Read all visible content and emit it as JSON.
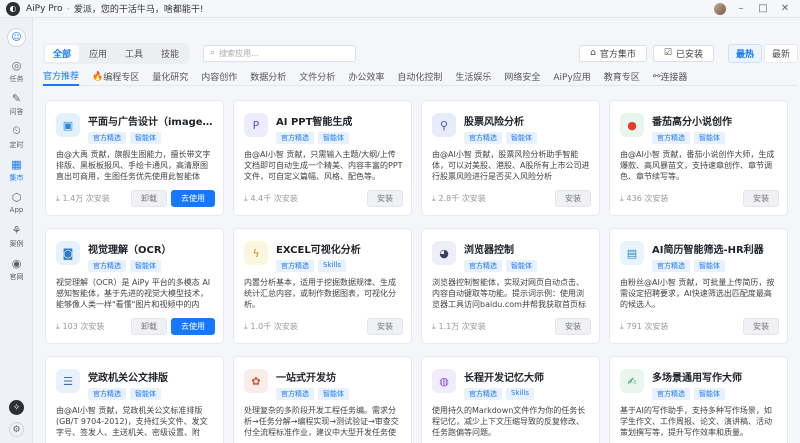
{
  "titlebar": {
    "app": "AiPy Pro",
    "sep": "-",
    "greeting": "爱派，您的干活牛马，啥都能干!"
  },
  "sidebar": [
    {
      "label": "任务",
      "icon": "◎"
    },
    {
      "label": "问答",
      "icon": "✎"
    },
    {
      "label": "定时",
      "icon": "⏲"
    },
    {
      "label": "集市",
      "icon": "▦"
    },
    {
      "label": "App",
      "icon": "⬡"
    },
    {
      "label": "案例",
      "icon": "⚘"
    },
    {
      "label": "官网",
      "icon": "◉"
    }
  ],
  "filters": {
    "segments": [
      "全部",
      "应用",
      "工具",
      "技能"
    ],
    "search_placeholder": "搜索应用...",
    "official_store": "官方集市",
    "installed": "已安装",
    "sort_hot": "最热",
    "sort_new": "最新"
  },
  "tabs": [
    "官方推荐",
    "编程专区",
    "量化研究",
    "内容创作",
    "数据分析",
    "文件分析",
    "办公效率",
    "自动化控制",
    "生活娱乐",
    "网络安全",
    "AiPy应用",
    "教育专区",
    "连接器"
  ],
  "cards": [
    {
      "title": "平面与广告设计（image2）",
      "tags": [
        "官方精选",
        "智能体"
      ],
      "desc": "由@大禹 贡献，旗舰生图能力，擅长带文字排版、黑板板报风、手绘卡通风，高清原图直出可商用，生图任务优先使用此智能体",
      "installs": "1.4万 次安装",
      "buttons": [
        "卸载",
        "去使用"
      ],
      "icon": "▣",
      "icon_bg": "#e3f1fb",
      "icon_color": "#2a8bd8"
    },
    {
      "title": "AI PPT智能生成",
      "tags": [
        "官方精选",
        "智能体"
      ],
      "desc": "由@AI小智 贡献，只需输入主题/大纲/上传文档即可自动生成一个精美、内容丰富的PPT文件，可自定义篇幅、风格、配色等。",
      "installs": "4.4千 次安装",
      "buttons": [
        "安装"
      ],
      "icon": "P",
      "icon_bg": "#ecebff",
      "icon_color": "#5b57d6"
    },
    {
      "title": "股票风险分析",
      "tags": [
        "官方精选",
        "智能体"
      ],
      "desc": "由@AI小智 贡献，股票风险分析助手智能体，可以对美股、港股、A股所有上市公司进行股票风险进行是否买入风险分析",
      "installs": "2.8千 次安装",
      "buttons": [
        "安装"
      ],
      "icon": "⚲",
      "icon_bg": "#e8ecf9",
      "icon_color": "#3b56b6"
    },
    {
      "title": "番茄高分小说创作",
      "tags": [
        "官方精选",
        "智能体"
      ],
      "desc": "由@AI小智 贡献，番茄小说创作大师，生成爆款、高风暴苗文，支持速章创作、章节调色、章节续写等。",
      "installs": "436 次安装",
      "buttons": [
        "安装"
      ],
      "icon": "●",
      "icon_bg": "#e9f5ec",
      "icon_color": "#e23b2e"
    },
    {
      "title": "视觉理解（OCR）",
      "tags": [
        "官方精选",
        "智能体"
      ],
      "desc": "视觉理解（OCR）是 AiPy 平台的多模态 AI 感知智能体，基于先进的视觉大模型技术，能够像人类一样\"看懂\"图片和视频中的内容。无论是提取图",
      "installs": "103 次安装",
      "buttons": [
        "卸载",
        "去使用"
      ],
      "icon": "◙",
      "icon_bg": "#e6f1fb",
      "icon_color": "#2c7ac9"
    },
    {
      "title": "EXCEL可视化分析",
      "tags": [
        "官方精选",
        "Skills"
      ],
      "desc": "内置分析基本，适用于挖掘数据规律、生成统计汇总内容，或制作数据图表，可视化分析。",
      "installs": "1.0千 次安装",
      "buttons": [
        "安装"
      ],
      "icon": "ϟ",
      "icon_bg": "#fbf6dd",
      "icon_color": "#c08a16"
    },
    {
      "title": "浏览器控制",
      "tags": [
        "官方精选",
        "智能体"
      ],
      "desc": "浏览器控制智能体，实现对网页自动点击、内容自动键取等功能。提示词示例：使用浏览器工具访问baidu.com并帮我获取首页标题",
      "installs": "1.1万 次安装",
      "buttons": [
        "安装"
      ],
      "icon": "◕",
      "icon_bg": "#edeef8",
      "icon_color": "#3a3f60"
    },
    {
      "title": "AI简历智能筛选-HR利器",
      "tags": [
        "官方精选",
        "智能体"
      ],
      "desc": "由粉丝@AI小智 贡献，可批量上传简历，按需设定招聘要求，AI快速筛选出匹配度最高的候选人。",
      "installs": "791 次安装",
      "buttons": [
        "安装"
      ],
      "icon": "▤",
      "icon_bg": "#e7f4fb",
      "icon_color": "#2a85c1"
    },
    {
      "title": "党政机关公文排版",
      "tags": [
        "官方精选",
        "智能体"
      ],
      "desc": "由@AI小智 贡献，党政机关公文标准排版(GB/T 9704-2012)，支持红头文件、发文字号、签发人、主送机关、密级设置、附注、版记等完整公",
      "installs": "",
      "buttons": [],
      "icon": "☰",
      "icon_bg": "#e8f1fc",
      "icon_color": "#2b6fc4"
    },
    {
      "title": "一站式开发坊",
      "tags": [
        "官方精选",
        "智能体"
      ],
      "desc": "处理复杂的多阶段开发工程任务编。需求分析→任务分解→编程实现→测试验证→审查交付全流程标准作业，建议中大型开发任务使用。",
      "installs": "",
      "buttons": [],
      "icon": "✿",
      "icon_bg": "#fbecec",
      "icon_color": "#d4532f"
    },
    {
      "title": "长程开发记忆大师",
      "tags": [
        "官方精选",
        "Skills"
      ],
      "desc": "使用持久的Markdown文件作为你的任务长程记忆，减少上下文压缩导致的反复修改、任务跑偏等问题。",
      "installs": "",
      "buttons": [],
      "icon": "◍",
      "icon_bg": "#f1ecfb",
      "icon_color": "#8a4fd6"
    },
    {
      "title": "多场景通用写作大师",
      "tags": [
        "官方精选",
        "智能体"
      ],
      "desc": "基于AI的写作助手，支持多种写作场景，如学生作文、工作周报、论文、演讲稿、活动策划撰写等，提升写作效率和质量。",
      "installs": "",
      "buttons": [],
      "icon": "✍",
      "icon_bg": "#e8f6ef",
      "icon_color": "#2f9f68"
    }
  ]
}
